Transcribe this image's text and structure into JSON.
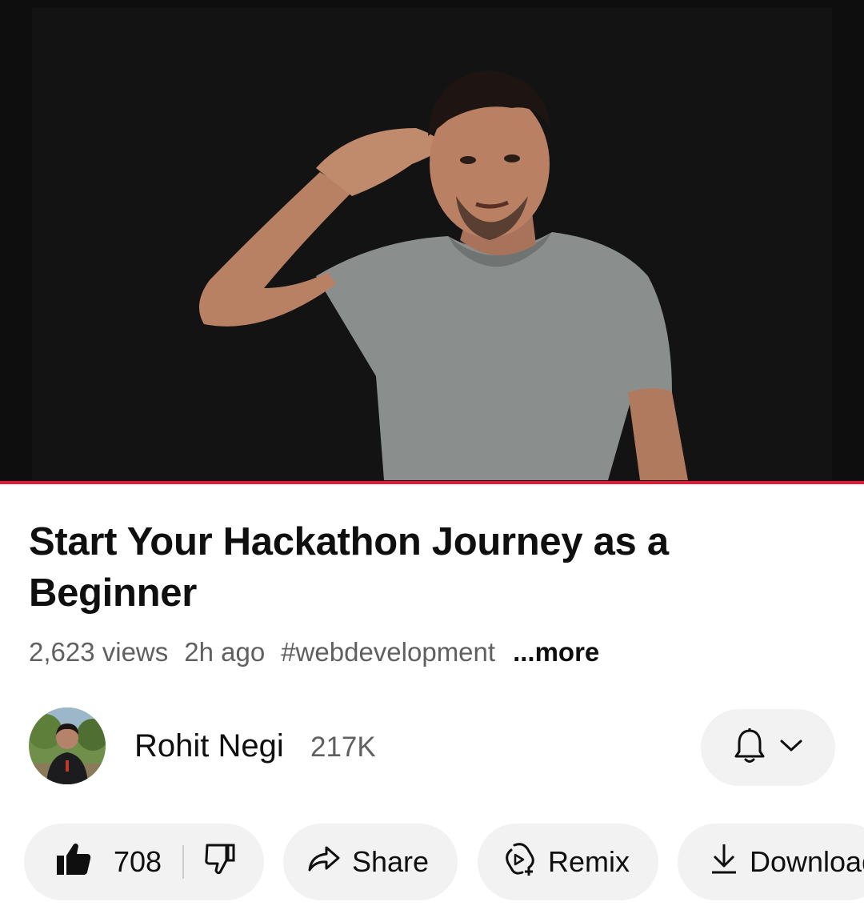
{
  "video": {
    "progress_fraction": 1.0,
    "accent_color": "#e8173a"
  },
  "details": {
    "title": "Start Your Hackathon Journey as a Beginner",
    "views": "2,623 views",
    "age": "2h ago",
    "hashtag": "#webdevelopment",
    "more_label": "...more"
  },
  "channel": {
    "name": "Rohit Negi",
    "subscribers": "217K",
    "avatar_icon": "channel-avatar",
    "notification_icon": "bell-icon",
    "dropdown_icon": "chevron-down-icon"
  },
  "actions": {
    "like_count": "708",
    "like_icon": "thumbs-up-icon",
    "dislike_icon": "thumbs-down-icon",
    "share_label": "Share",
    "share_icon": "share-arrow-icon",
    "remix_label": "Remix",
    "remix_icon": "remix-icon",
    "download_label": "Download",
    "download_icon": "download-icon"
  }
}
